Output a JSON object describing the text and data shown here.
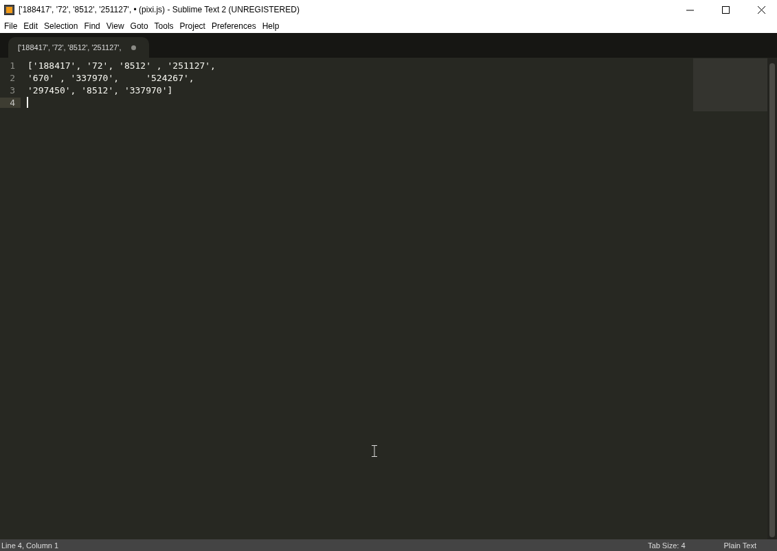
{
  "window": {
    "title": "['188417', '72', '8512', '251127', • (pixi.js) - Sublime Text 2 (UNREGISTERED)"
  },
  "menu": [
    {
      "label": "File"
    },
    {
      "label": "Edit"
    },
    {
      "label": "Selection"
    },
    {
      "label": "Find"
    },
    {
      "label": "View"
    },
    {
      "label": "Goto"
    },
    {
      "label": "Tools"
    },
    {
      "label": "Project"
    },
    {
      "label": "Preferences"
    },
    {
      "label": "Help"
    }
  ],
  "tabs": [
    {
      "label": "['188417', '72', '8512', '251127',",
      "selected": true,
      "modified": true
    }
  ],
  "editor": {
    "lines": [
      {
        "number": "1",
        "text": "['188417', '72', '8512' , '251127',",
        "current": false
      },
      {
        "number": "2",
        "text": "'670' , '337970',     '524267',",
        "current": false
      },
      {
        "number": "3",
        "text": "'297450', '8512', '337970']",
        "current": false
      },
      {
        "number": "4",
        "current": true
      }
    ]
  },
  "status_bar": {
    "position": "Line 4, Column 1",
    "tab_size": "Tab Size: 4",
    "syntax": "Plain Text"
  }
}
